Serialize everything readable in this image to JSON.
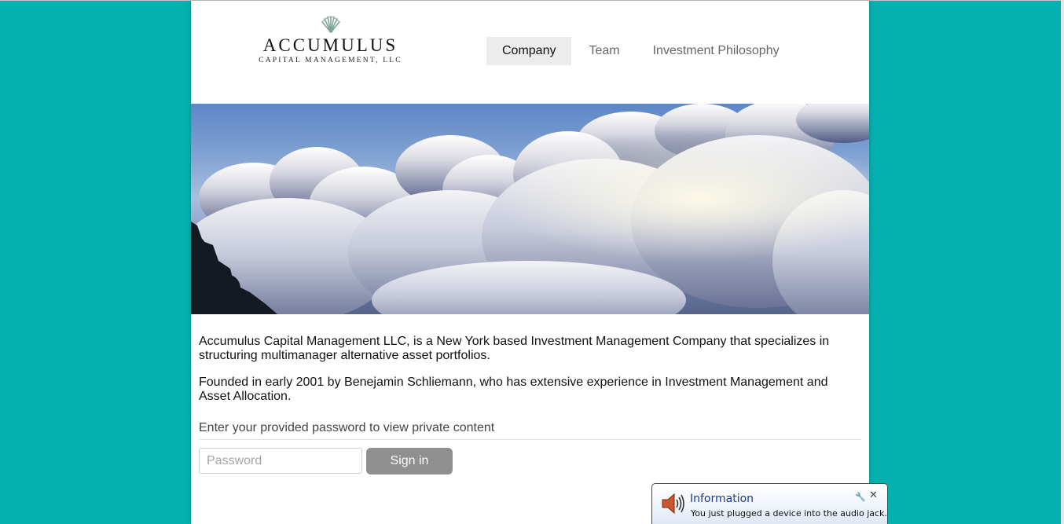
{
  "logo": {
    "name": "ACCUMULUS",
    "subtitle": "CAPITAL MANAGEMENT, LLC",
    "icon": "shell-icon"
  },
  "nav": {
    "items": [
      {
        "label": "Company",
        "active": true
      },
      {
        "label": "Team",
        "active": false
      },
      {
        "label": "Investment Philosophy",
        "active": false
      }
    ]
  },
  "content": {
    "paragraph1": "Accumulus Capital Management LLC, is a New York based Investment Management Company that specializes in structuring multimanager alternative asset portfolios.",
    "paragraph2": "Founded in early 2001 by Benejamin Schliemann, who has extensive experience in Investment Management and Asset Allocation.",
    "password_prompt": "Enter your provided password to view private content"
  },
  "login": {
    "password_placeholder": "Password",
    "password_value": "",
    "signin_label": "Sign in"
  },
  "notification": {
    "title": "Information",
    "message": "You just plugged a device into the audio jack.",
    "icon": "speaker-icon",
    "tool_icon": "wrench-icon",
    "close_icon": "close-icon"
  },
  "colors": {
    "background": "#05b1b0",
    "signin_button": "#8f8f8f",
    "active_tab": "#ececec"
  }
}
